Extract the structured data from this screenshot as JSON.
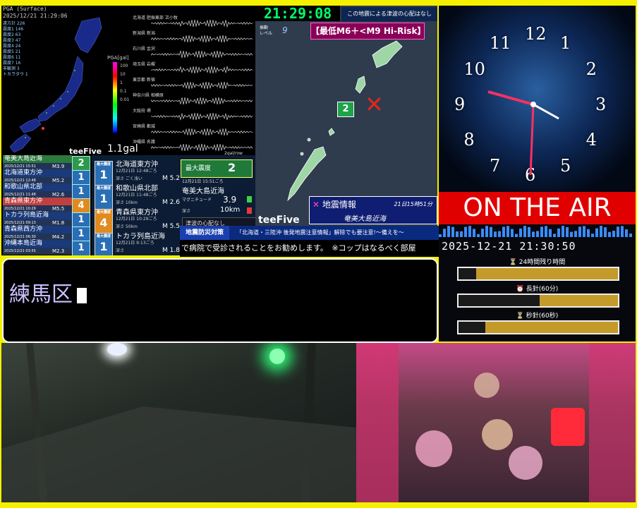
{
  "map_panel": {
    "header_line1": "PGA (Surface)",
    "header_line2": "2025/12/21 21:29:06",
    "stations": [
      "遠方計 226",
      "震度1 146",
      "震度2 63",
      "震度3 47",
      "震度4 24",
      "震度5 21",
      "震度6 11",
      "震度7 16",
      "非観測 3",
      "トカラタウ 1"
    ],
    "pga_title": "PGA[gal]",
    "pga_ticks": [
      "100",
      "10",
      "1",
      "0.1",
      "0.01"
    ],
    "gal_label": "1.1gal",
    "brand": "teeFive",
    "wave_labels": [
      "北海道 胆振東部 苫小牧",
      "新潟県 新潟",
      "石川県 金沢",
      "埼玉県 岩槻",
      "東京都 新宿",
      "神奈川県 相模原",
      "大阪府 堺",
      "宮崎県 都城",
      "沖縄県 名護"
    ],
    "wave_unit": "2gal/row"
  },
  "quake_list": [
    {
      "name": "奄美大島近海",
      "date": "2025/12/21 15:51",
      "mag": "M3.9",
      "intensity": "2",
      "color": "#2c7a3e"
    },
    {
      "name": "北海道東方沖",
      "date": "2025/12/21 12:48",
      "mag": "M5.2",
      "intensity": "1",
      "color": "#1a3a7a"
    },
    {
      "name": "和歌山県北部",
      "date": "2025/12/21 11:48",
      "mag": "M2.6",
      "intensity": "1",
      "color": "#1a3a7a"
    },
    {
      "name": "青森県東方沖",
      "date": "2025/12/21 10:29",
      "mag": "M5.5",
      "intensity": "4",
      "color": "#c04040"
    },
    {
      "name": "トカラ列島近海",
      "date": "2025/12/21 09:13",
      "mag": "M1.8",
      "intensity": "1",
      "color": "#1a3a7a"
    },
    {
      "name": "青森県西方沖",
      "date": "2025/12/21 06:30",
      "mag": "M4.2",
      "intensity": "1",
      "color": "#1a3a7a"
    },
    {
      "name": "沖縄本島近海",
      "date": "2025/12/21 03:55",
      "mag": "M2.3",
      "intensity": "1",
      "color": "#1a3a7a"
    }
  ],
  "detail_list": [
    {
      "badge_lbl": "最大震度",
      "intensity": "1",
      "name": "北海道東方沖",
      "date": "12月21日 12:48ごろ",
      "info": "深さ ごく浅い",
      "mag": "M 5.2"
    },
    {
      "badge_lbl": "最大震度",
      "intensity": "1",
      "name": "和歌山県北部",
      "date": "12月21日 11:48ごろ",
      "info": "深さ 10km",
      "mag": "M 2.6"
    },
    {
      "badge_lbl": "最大震度",
      "intensity": "4",
      "name": "青森県東方沖",
      "date": "12月21日 10:29ごろ",
      "info": "深さ 50km",
      "mag": "M 5.5"
    },
    {
      "badge_lbl": "最大震度",
      "intensity": "1",
      "name": "トカラ列島近海",
      "date": "12月21日 9:13ごろ",
      "info": "深さ",
      "mag": "M 1.8"
    }
  ],
  "recent_detail": {
    "max_label": "最大震度",
    "max_value": "2",
    "date": "12月21日 15:51ごろ",
    "name": "奄美大島近海",
    "mag_label": "マグニチュード",
    "mag_value": "3.9",
    "depth_label": "深さ",
    "depth_value": "10km",
    "tsunami": "津波の心配なし"
  },
  "center_map": {
    "digital_time": "21:29:08",
    "tsunami_msg": "この地震による津波の心配はなし",
    "shindo_label_1": "振動",
    "shindo_label_2": "レベル",
    "shindo_value": "9",
    "risk_label": "【最低M6＋<M9 Hi-Risk】",
    "marker_value": "2",
    "brand": "teeFive",
    "info_title": "地震情報",
    "info_time": "21日15時51分",
    "info_area": "奄美大島近海"
  },
  "ticker": {
    "tag": "地震防災対策",
    "text": "「北海道・三陸沖 後発地震注意情報」解除でも要注意!～備えを～",
    "scroll": "で病院で受診されることをお勧めします。　※コップはなるべく部屋"
  },
  "location": {
    "text": "練馬区"
  },
  "clock": {
    "numerals": [
      "12",
      "1",
      "2",
      "3",
      "4",
      "5",
      "6",
      "7",
      "8",
      "9",
      "10",
      "11"
    ]
  },
  "onair": {
    "label": "ON THE AIR"
  },
  "stats": {
    "datetime": "2025-12-21 21:30:50",
    "bar1_label": "⏳ 24時間残り時間",
    "bar1_elapsed": 0.11,
    "bar2_label": "⏰ 長針(60分)",
    "bar2_elapsed": 0.51,
    "bar3_label": "⏳ 秒針(60秒)",
    "bar3_elapsed": 0.17,
    "bar_color": "#c49a2a"
  }
}
